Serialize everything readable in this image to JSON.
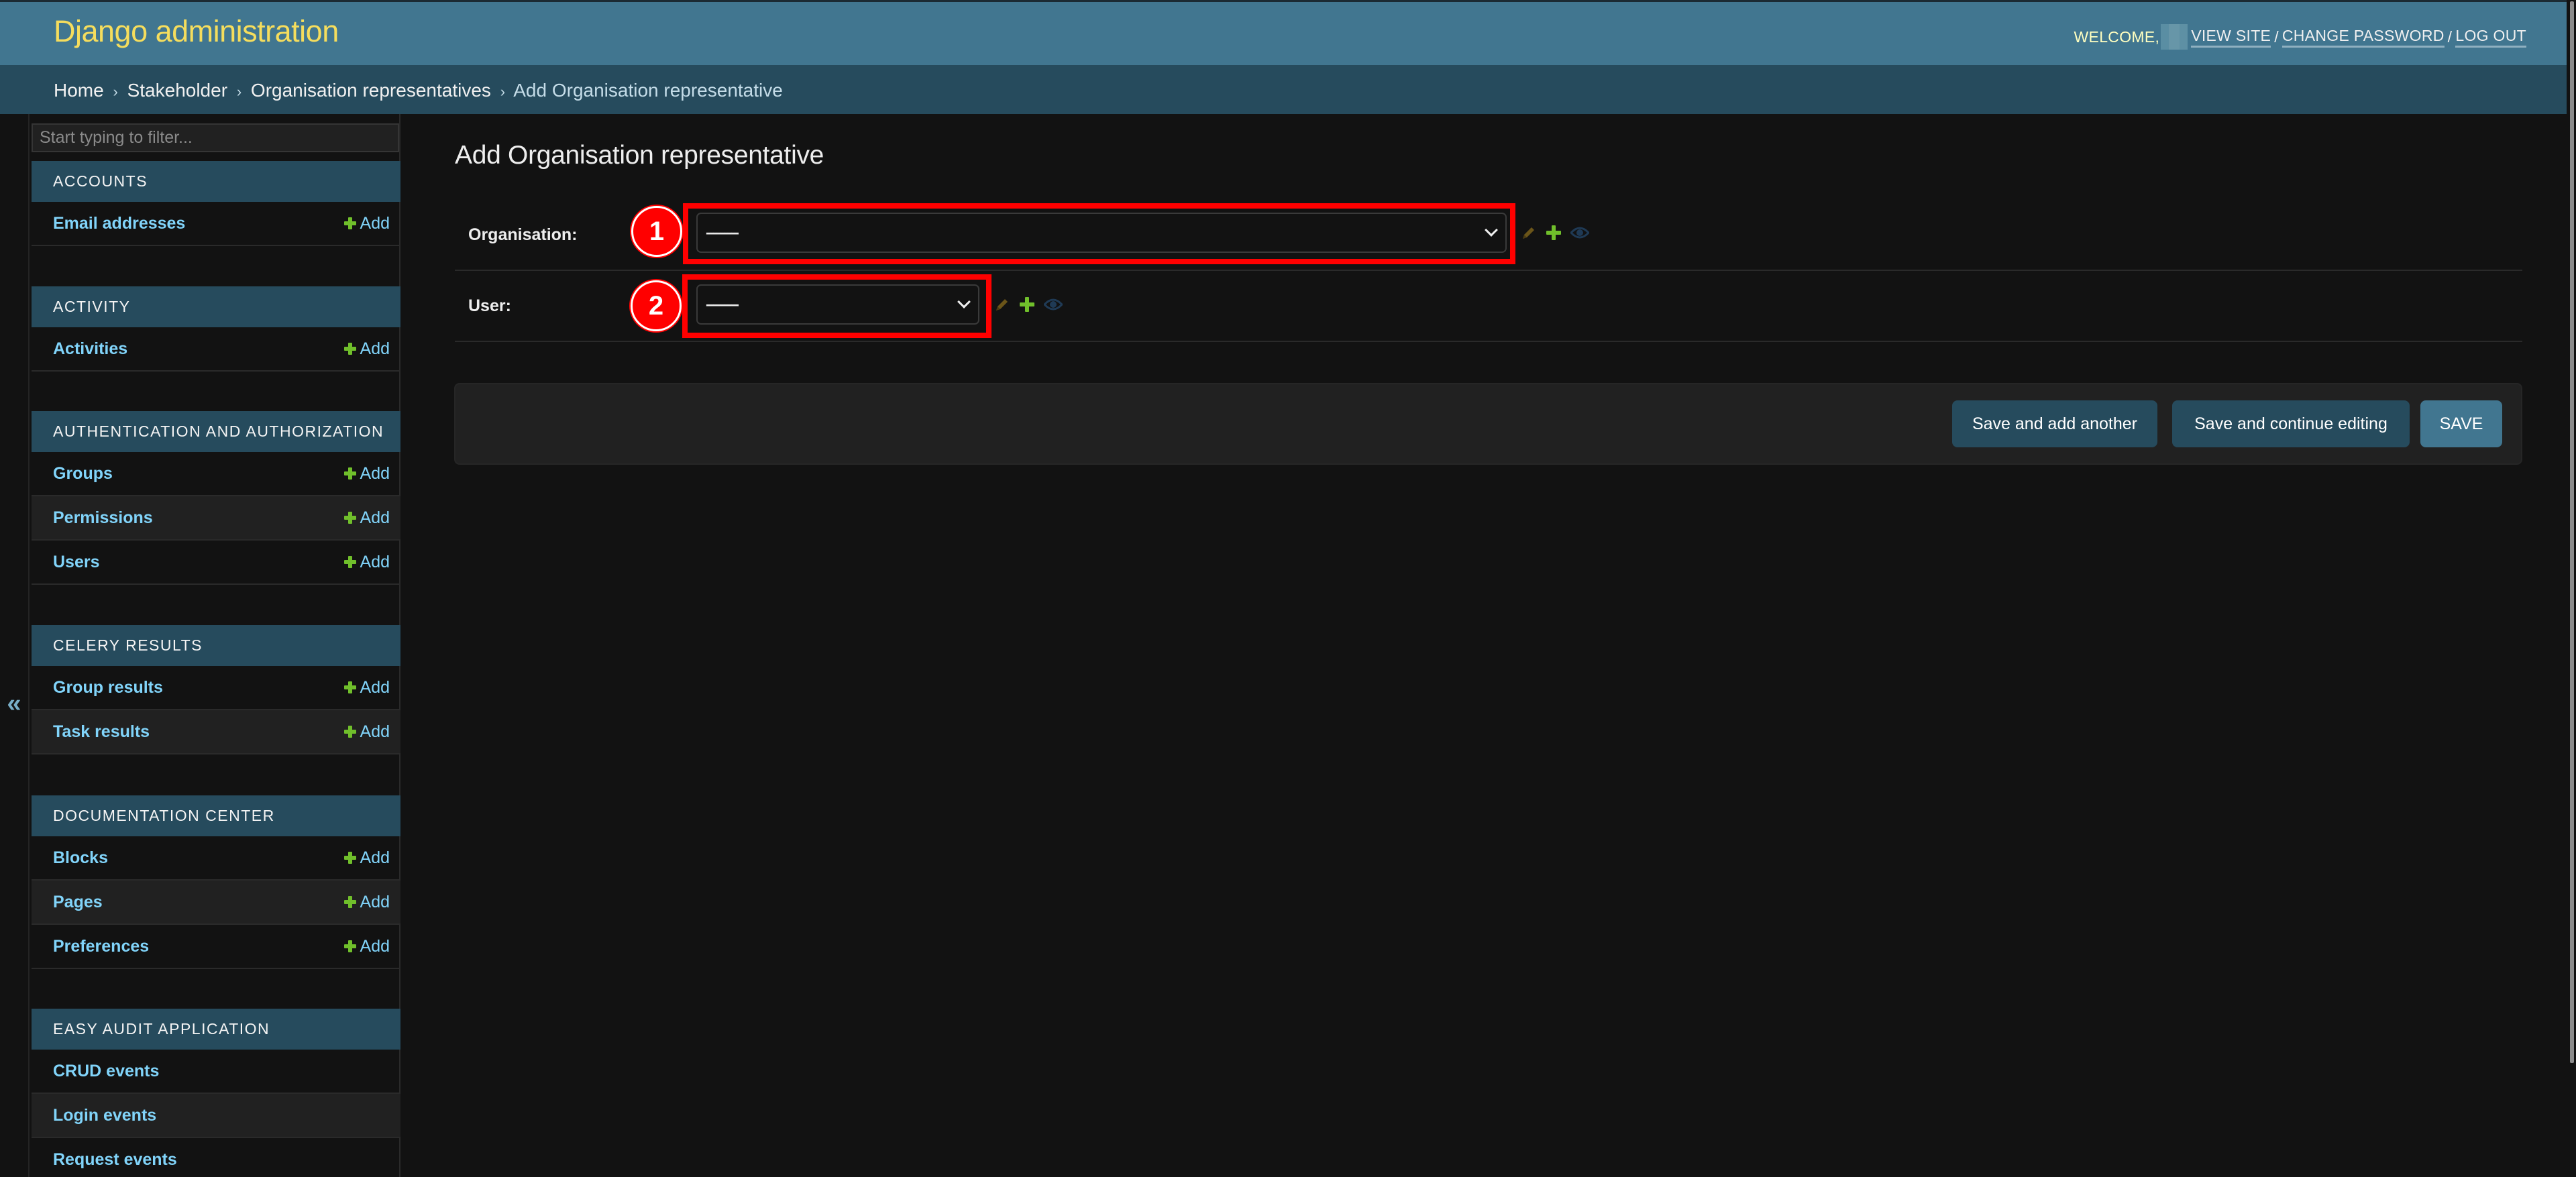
{
  "header": {
    "site_title": "Django administration",
    "welcome": "WELCOME,",
    "links": [
      {
        "label": "VIEW SITE"
      },
      {
        "label": "CHANGE PASSWORD"
      },
      {
        "label": "LOG OUT"
      }
    ],
    "separator": "/"
  },
  "breadcrumbs": {
    "items": [
      "Home",
      "Stakeholder",
      "Organisation representatives"
    ],
    "current": "Add Organisation representative",
    "separator": "›"
  },
  "sidebar": {
    "toggle_label": "«",
    "filter_placeholder": "Start typing to filter...",
    "add_label": "Add",
    "modules": [
      {
        "caption": "ACCOUNTS",
        "items": [
          {
            "label": "Email addresses",
            "add": true
          }
        ]
      },
      {
        "caption": "ACTIVITY",
        "items": [
          {
            "label": "Activities",
            "add": true
          }
        ]
      },
      {
        "caption": "AUTHENTICATION AND AUTHORIZATION",
        "items": [
          {
            "label": "Groups",
            "add": true
          },
          {
            "label": "Permissions",
            "add": true
          },
          {
            "label": "Users",
            "add": true
          }
        ]
      },
      {
        "caption": "CELERY RESULTS",
        "items": [
          {
            "label": "Group results",
            "add": true
          },
          {
            "label": "Task results",
            "add": true
          }
        ]
      },
      {
        "caption": "DOCUMENTATION CENTER",
        "items": [
          {
            "label": "Blocks",
            "add": true
          },
          {
            "label": "Pages",
            "add": true
          },
          {
            "label": "Preferences",
            "add": true
          }
        ]
      },
      {
        "caption": "EASY AUDIT APPLICATION",
        "items": [
          {
            "label": "CRUD events",
            "add": false
          },
          {
            "label": "Login events",
            "add": false
          },
          {
            "label": "Request events",
            "add": false
          }
        ]
      }
    ]
  },
  "main": {
    "title": "Add Organisation representative",
    "fields": [
      {
        "label": "Organisation:",
        "value": "---------",
        "annotation": "1"
      },
      {
        "label": "User:",
        "value": "---------",
        "annotation": "2"
      }
    ],
    "buttons": {
      "save_add_another": "Save and add another",
      "save_continue": "Save and continue editing",
      "save": "SAVE"
    }
  },
  "colors": {
    "header_bg": "#417690",
    "breadcrumb_bg": "#264b5d",
    "title_yellow": "#f5dd5d",
    "link_blue": "#81d4fa",
    "add_green": "#70bf2b",
    "annotation_red": "#ff0000",
    "page_bg": "#121212"
  }
}
